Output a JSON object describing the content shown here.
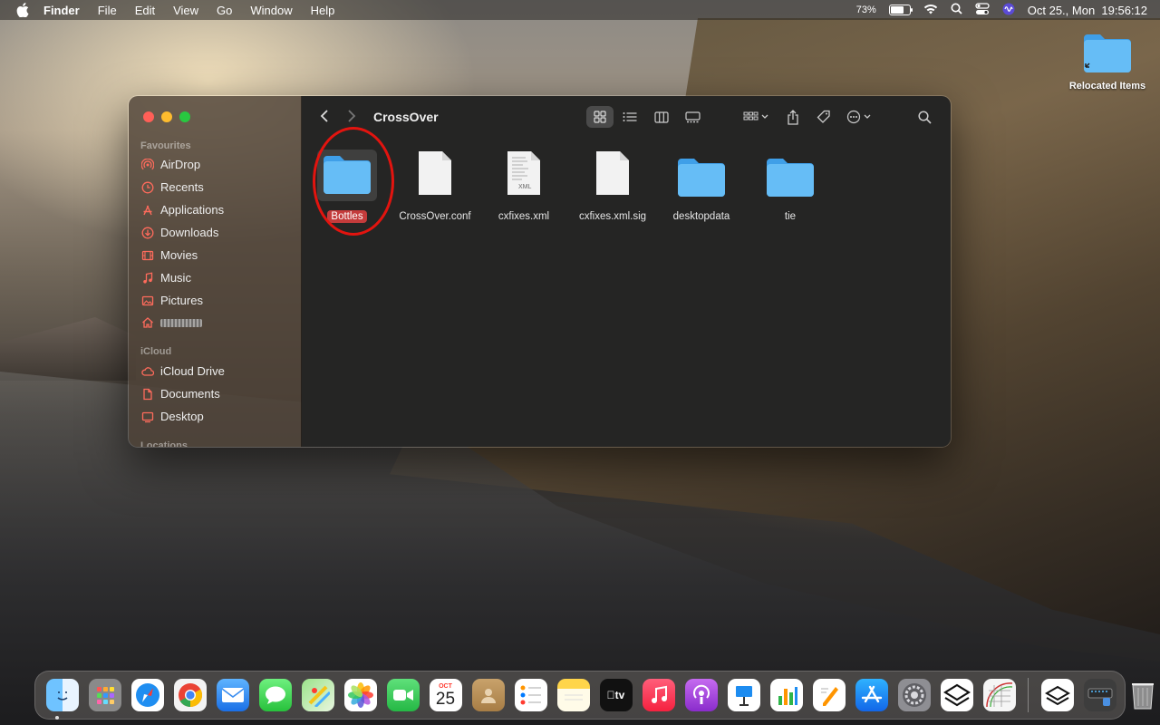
{
  "menubar": {
    "app": "Finder",
    "items": [
      "File",
      "Edit",
      "View",
      "Go",
      "Window",
      "Help"
    ],
    "battery": "73%",
    "battery_level": 0.73,
    "datetime": "Oct 25., Mon  19:56:12"
  },
  "desktop": {
    "icon_label": "Relocated Items"
  },
  "finder": {
    "title": "CrossOver",
    "sidebar": {
      "favourites_header": "Favourites",
      "favourites": [
        "AirDrop",
        "Recents",
        "Applications",
        "Downloads",
        "Movies",
        "Music",
        "Pictures"
      ],
      "icloud_header": "iCloud",
      "icloud": [
        "iCloud Drive",
        "Documents",
        "Desktop"
      ],
      "locations_header": "Locations"
    },
    "files": [
      {
        "name": "Bottles",
        "kind": "folder",
        "selected": true
      },
      {
        "name": "CrossOver.conf",
        "kind": "document"
      },
      {
        "name": "cxfixes.xml",
        "kind": "xml"
      },
      {
        "name": "cxfixes.xml.sig",
        "kind": "document"
      },
      {
        "name": "desktopdata",
        "kind": "folder"
      },
      {
        "name": "tie",
        "kind": "folder"
      }
    ],
    "xml_badge": "XML"
  },
  "dock": {
    "calendar_month": "OCT",
    "calendar_day": "25",
    "tv_label": "tv",
    "apps": [
      "finder",
      "launchpad",
      "safari",
      "chrome",
      "mail",
      "messages",
      "maps",
      "photos",
      "facetime",
      "calendar",
      "contacts",
      "reminders",
      "notes",
      "tv",
      "music",
      "podcasts",
      "keynote",
      "numbers",
      "pages",
      "app-store",
      "system-preferences",
      "crossover",
      "diagram-app"
    ]
  },
  "colors": {
    "folder": "#5bb4f2",
    "selection": "#c43b3b",
    "annotation_ring": "#e2140f",
    "sidebar_icon": "#ff6b5c"
  }
}
